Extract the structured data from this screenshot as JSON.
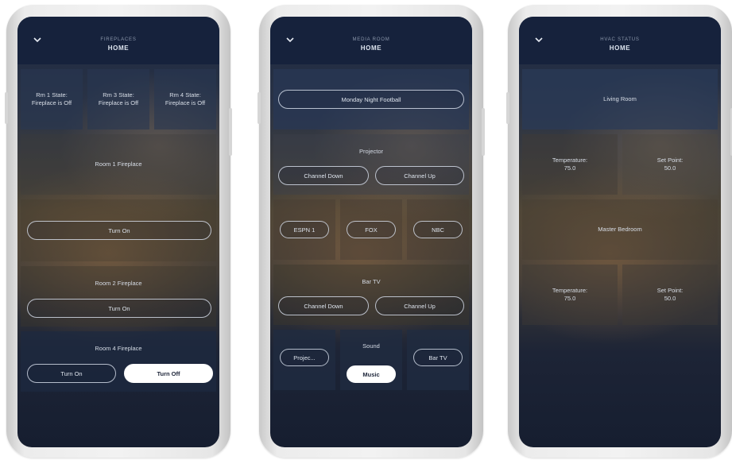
{
  "screens": [
    {
      "header": {
        "subtitle": "FIREPLACES",
        "title": "HOME"
      },
      "state_tiles": [
        "Rm 1 State:\nFireplace is Off",
        "Rm 3 State:\nFireplace is Off",
        "Rm 4 State:\nFireplace is Off"
      ],
      "room1": {
        "label": "Room 1 Fireplace",
        "turn_on": "Turn On"
      },
      "room2": {
        "label": "Room 2 Fireplace",
        "turn_on": "Turn On"
      },
      "room4": {
        "label": "Room 4 Fireplace",
        "turn_on": "Turn On",
        "turn_off": "Turn Off"
      }
    },
    {
      "header": {
        "subtitle": "MEDIA ROOM",
        "title": "HOME"
      },
      "preset": "Monday Night Football",
      "projector": {
        "label": "Projector",
        "down": "Channel Down",
        "up": "Channel Up"
      },
      "channels": [
        "ESPN 1",
        "FOX",
        "NBC"
      ],
      "bar_tv": {
        "label": "Bar TV",
        "down": "Channel Down",
        "up": "Channel Up"
      },
      "source": {
        "label": "Sound",
        "left": "Projec...",
        "active": "Music",
        "right": "Bar TV"
      }
    },
    {
      "header": {
        "subtitle": "HVAC STATUS",
        "title": "HOME"
      },
      "living": {
        "label": "Living Room",
        "temp_label": "Temperature:",
        "temp_value": "75.0",
        "set_label": "Set Point:",
        "set_value": "50.0"
      },
      "master": {
        "label": "Master Bedroom",
        "temp_label": "Temperature:",
        "temp_value": "75.0",
        "set_label": "Set Point:",
        "set_value": "50.0"
      }
    }
  ]
}
